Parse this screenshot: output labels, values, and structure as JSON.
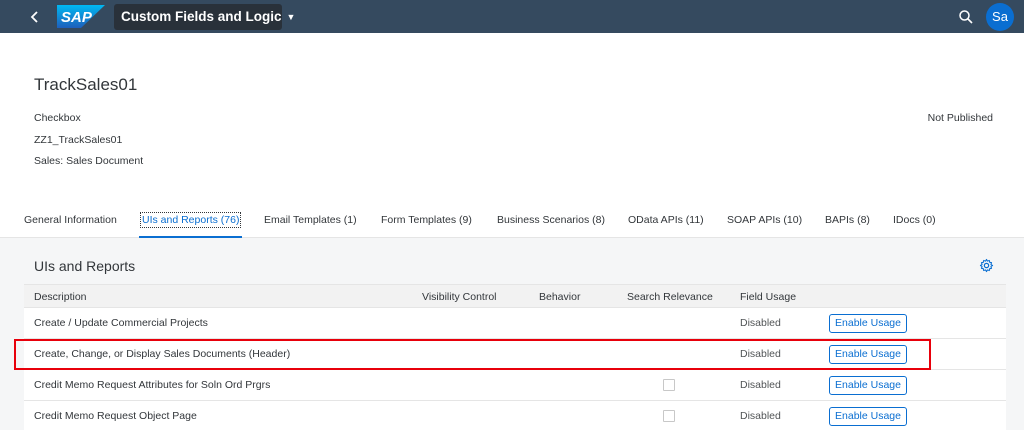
{
  "shell": {
    "logo_text": "SAP",
    "app_title": "Custom Fields and Logic",
    "avatar_initials": "Sa",
    "icons": [
      "back-icon",
      "search-icon",
      "caret-down-icon"
    ],
    "brand_color": "#0a6ed1",
    "bar_color": "#354a5f"
  },
  "header": {
    "title": "TrackSales01",
    "type": "Checkbox",
    "identifier": "ZZ1_TrackSales01",
    "business_context": "Sales: Sales Document",
    "status": "Not Published"
  },
  "tabs": [
    {
      "label": "General Information"
    },
    {
      "label": "UIs and Reports (76)"
    },
    {
      "label": "Email Templates (1)"
    },
    {
      "label": "Form Templates (9)"
    },
    {
      "label": "Business Scenarios (8)"
    },
    {
      "label": "OData APIs (11)"
    },
    {
      "label": "SOAP APIs (10)"
    },
    {
      "label": "BAPIs (8)"
    },
    {
      "label": "IDocs (0)"
    }
  ],
  "active_tab": "UIs and Reports (76)",
  "section": {
    "title": "UIs and Reports",
    "settings_icon": "gear-icon"
  },
  "table": {
    "columns": [
      "Description",
      "Visibility Control",
      "Behavior",
      "Search Relevance",
      "Field Usage"
    ],
    "rows": [
      {
        "description": "Create / Update Commercial Projects",
        "search_checkbox": false,
        "field_usage": "Disabled",
        "action": "Enable Usage"
      },
      {
        "description": "Create, Change, or Display Sales Documents (Header)",
        "search_checkbox": false,
        "field_usage": "Disabled",
        "action": "Enable Usage"
      },
      {
        "description": "Credit Memo Request Attributes for Soln Ord Prgrs",
        "search_checkbox": true,
        "field_usage": "Disabled",
        "action": "Enable Usage"
      },
      {
        "description": "Credit Memo Request Object Page",
        "search_checkbox": true,
        "field_usage": "Disabled",
        "action": "Enable Usage"
      }
    ]
  },
  "highlight_color": "#e8000b"
}
